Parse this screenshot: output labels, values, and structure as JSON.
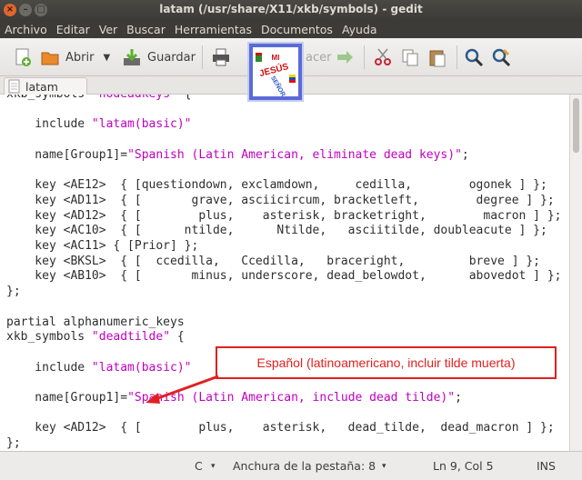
{
  "window": {
    "title": "latam (/usr/share/X11/xkb/symbols) - gedit"
  },
  "menu": [
    "Archivo",
    "Editar",
    "Ver",
    "Buscar",
    "Herramientas",
    "Documentos",
    "Ayuda"
  ],
  "toolbar": {
    "open_label": "Abrir",
    "save_label": "Guardar",
    "find_partial": "acer"
  },
  "tab": {
    "label": "latam"
  },
  "editor": {
    "lines": [
      "xkb_symbols \"nodeadkeys\" {",
      "",
      "    include \"latam(basic)\"",
      "",
      "    name[Group1]=\"Spanish (Latin American, eliminate dead keys)\";",
      "",
      "    key <AE12>  { [questiondown, exclamdown,     cedilla,        ogonek ] };",
      "    key <AD11>  { [       grave, asciicircum, bracketleft,        degree ] };",
      "    key <AD12>  { [        plus,    asterisk, bracketright,        macron ] };",
      "    key <AC10>  { [      ntilde,      Ntilde,   asciitilde, doubleacute ] };",
      "    key <AC11> { [Prior] };",
      "    key <BKSL>  { [  ccedilla,   Ccedilla,   braceright,         breve ] };",
      "    key <AB10>  { [       minus, underscore, dead_belowdot,      abovedot ] };",
      "};",
      "",
      "partial alphanumeric_keys",
      "xkb_symbols \"deadtilde\" {",
      "",
      "    include \"latam(basic)\"",
      "",
      "    name[Group1]=\"Spanish (Latin American, include dead tilde)\";",
      "",
      "    key <AD12>  { [        plus,    asterisk,   dead_tilde,  dead_macron ] };",
      "};"
    ]
  },
  "annotation": {
    "text": "Español (latinoamericano, incluir tilde muerta)"
  },
  "status": {
    "language": "C",
    "tab_width": "Anchura de la pestaña: 8",
    "position": "Ln 9, Col 5",
    "mode": "INS"
  },
  "colors": {
    "string": "#c000c0",
    "annotation": "#e02020",
    "logo_blue": "#5a6bd8"
  },
  "logo": {
    "text": [
      "JESÚS",
      "MI",
      "SEÑOR"
    ]
  }
}
